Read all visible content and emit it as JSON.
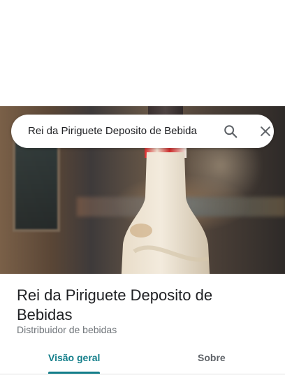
{
  "search": {
    "query": "Rei da Piriguete Deposito de Bebida",
    "search_icon": "search-icon",
    "close_icon": "close-icon"
  },
  "hero": {
    "photo": "place-photo"
  },
  "place": {
    "name": "Rei da Piriguete Deposito de Bebidas",
    "category": "Distribuidor de bebidas"
  },
  "tabs": [
    {
      "label": "Visão geral",
      "active": true
    },
    {
      "label": "Sobre",
      "active": false
    }
  ],
  "colors": {
    "accent": "#137e8a",
    "text_primary": "#202124",
    "text_secondary": "#70757a"
  }
}
